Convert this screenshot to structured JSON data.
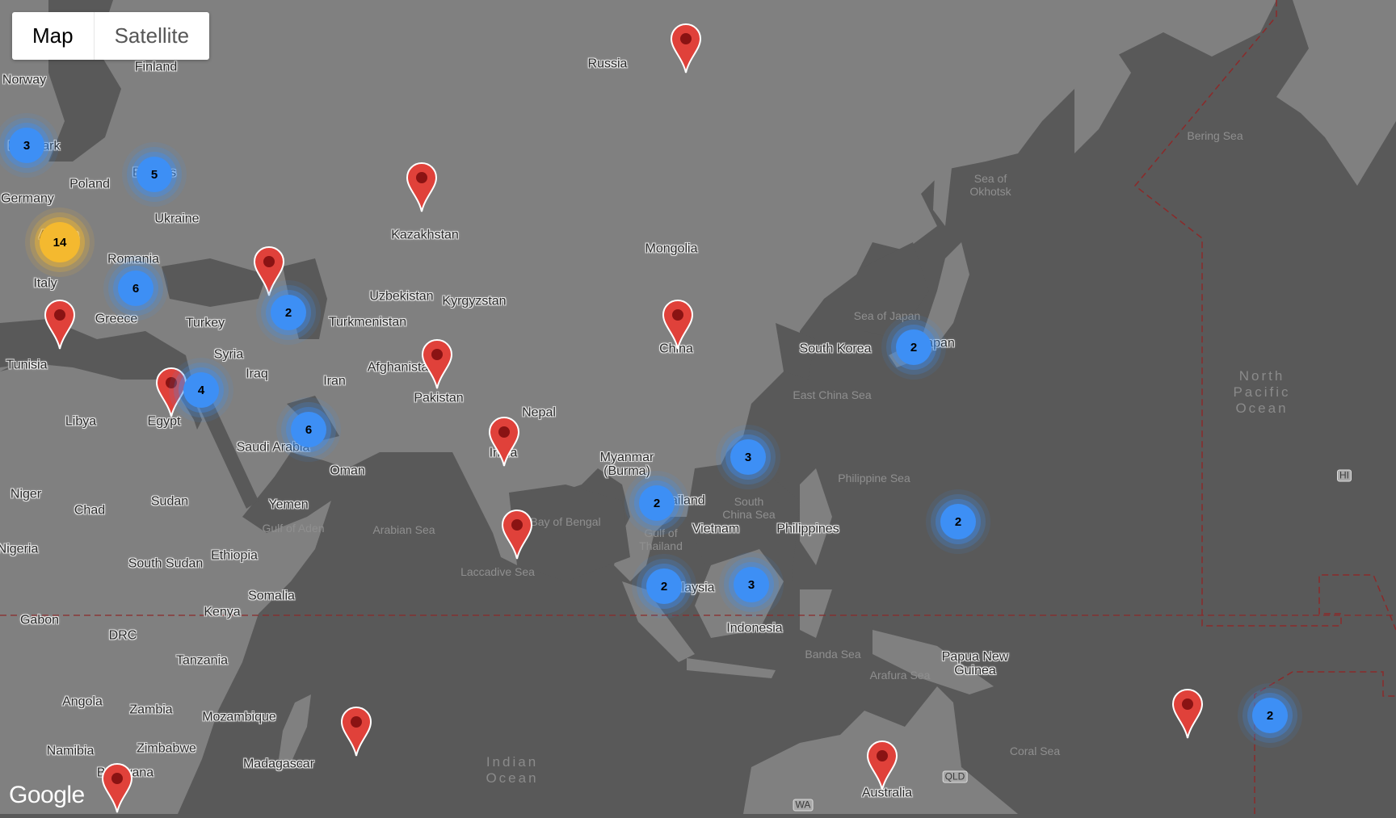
{
  "map_type_control": {
    "options": [
      "Map",
      "Satellite"
    ],
    "selected": "Map"
  },
  "attribution": "Google",
  "colors": {
    "water": "#595959",
    "land": "#808080",
    "marker": "#e0413a",
    "cluster_small": "#3d8ff5",
    "cluster_large": "#f4b92f",
    "boundary": "#8b2a2a"
  },
  "country_labels": [
    {
      "name": "Finland"
    },
    {
      "name": "Norway"
    },
    {
      "name": "Denmark"
    },
    {
      "name": "Poland"
    },
    {
      "name": "Belarus"
    },
    {
      "name": "Germany"
    },
    {
      "name": "Ukraine"
    },
    {
      "name": "Austria"
    },
    {
      "name": "Romania"
    },
    {
      "name": "Italy"
    },
    {
      "name": "Greece"
    },
    {
      "name": "Turkey"
    },
    {
      "name": "Tunisia"
    },
    {
      "name": "Syria"
    },
    {
      "name": "Iraq"
    },
    {
      "name": "Iran"
    },
    {
      "name": "Libya"
    },
    {
      "name": "Egypt"
    },
    {
      "name": "Saudi Arabia"
    },
    {
      "name": "Oman"
    },
    {
      "name": "Niger"
    },
    {
      "name": "Chad"
    },
    {
      "name": "Sudan"
    },
    {
      "name": "Yemen"
    },
    {
      "name": "Nigeria"
    },
    {
      "name": "South Sudan"
    },
    {
      "name": "Ethiopia"
    },
    {
      "name": "Somalia"
    },
    {
      "name": "Gabon"
    },
    {
      "name": "Kenya"
    },
    {
      "name": "DRC"
    },
    {
      "name": "Tanzania"
    },
    {
      "name": "Angola"
    },
    {
      "name": "Zambia"
    },
    {
      "name": "Mozambique"
    },
    {
      "name": "Namibia"
    },
    {
      "name": "Zimbabwe"
    },
    {
      "name": "Botswana"
    },
    {
      "name": "Madagascar"
    },
    {
      "name": "Russia"
    },
    {
      "name": "Kazakhstan"
    },
    {
      "name": "Uzbekistan"
    },
    {
      "name": "Kyrgyzstan"
    },
    {
      "name": "Turkmenistan"
    },
    {
      "name": "Afghanistan"
    },
    {
      "name": "Pakistan"
    },
    {
      "name": "Nepal"
    },
    {
      "name": "India"
    },
    {
      "name": "Mongolia"
    },
    {
      "name": "China"
    },
    {
      "name": "South Korea"
    },
    {
      "name": "Japan"
    },
    {
      "name": "Myanmar\n(Burma)"
    },
    {
      "name": "Thailand"
    },
    {
      "name": "Vietnam"
    },
    {
      "name": "Philippines"
    },
    {
      "name": "Malaysia"
    },
    {
      "name": "Indonesia"
    },
    {
      "name": "Papua New\nGuinea"
    },
    {
      "name": "Australia"
    }
  ],
  "sea_labels": [
    {
      "name": "Bering Sea"
    },
    {
      "name": "Sea of\nOkhotsk"
    },
    {
      "name": "Sea of Japan"
    },
    {
      "name": "East China Sea"
    },
    {
      "name": "Philippine Sea"
    },
    {
      "name": "South\nChina Sea"
    },
    {
      "name": "Gulf of\nThailand"
    },
    {
      "name": "Bay of Bengal"
    },
    {
      "name": "Arabian Sea"
    },
    {
      "name": "Gulf of Aden"
    },
    {
      "name": "Laccadive Sea"
    },
    {
      "name": "Banda Sea"
    },
    {
      "name": "Arafura Sea"
    },
    {
      "name": "Coral Sea"
    }
  ],
  "ocean_labels": [
    {
      "name": "North\nPacific\nOcean"
    },
    {
      "name": "Indian\nOcean"
    }
  ],
  "state_labels": [
    {
      "name": "HI"
    },
    {
      "name": "QLD"
    },
    {
      "name": "WA"
    }
  ],
  "markers": [
    {
      "location": "Russia"
    },
    {
      "location": "Kazakhstan"
    },
    {
      "location": "Caucasus"
    },
    {
      "location": "Tunisia/Sicily"
    },
    {
      "location": "Egypt"
    },
    {
      "location": "Pakistan"
    },
    {
      "location": "China"
    },
    {
      "location": "India"
    },
    {
      "location": "Sri Lanka"
    },
    {
      "location": "Indian Ocean (Mauritius)"
    },
    {
      "location": "South Africa"
    },
    {
      "location": "Australia"
    },
    {
      "location": "Fiji"
    }
  ],
  "clusters": [
    {
      "count": "3",
      "near": "Denmark",
      "color": "blue"
    },
    {
      "count": "5",
      "near": "Belarus",
      "color": "blue"
    },
    {
      "count": "14",
      "near": "Austria",
      "color": "yellow"
    },
    {
      "count": "6",
      "near": "Bulgaria",
      "color": "blue"
    },
    {
      "count": "2",
      "near": "Azerbaijan",
      "color": "blue"
    },
    {
      "count": "4",
      "near": "Israel",
      "color": "blue"
    },
    {
      "count": "6",
      "near": "Qatar",
      "color": "blue"
    },
    {
      "count": "2",
      "near": "Japan",
      "color": "blue"
    },
    {
      "count": "3",
      "near": "Hong Kong",
      "color": "blue"
    },
    {
      "count": "2",
      "near": "Thailand",
      "color": "blue"
    },
    {
      "count": "2",
      "near": "Pacific",
      "color": "blue"
    },
    {
      "count": "2",
      "near": "Malaysia",
      "color": "blue"
    },
    {
      "count": "3",
      "near": "Borneo",
      "color": "blue"
    },
    {
      "count": "2",
      "near": "Samoa",
      "color": "blue"
    }
  ]
}
